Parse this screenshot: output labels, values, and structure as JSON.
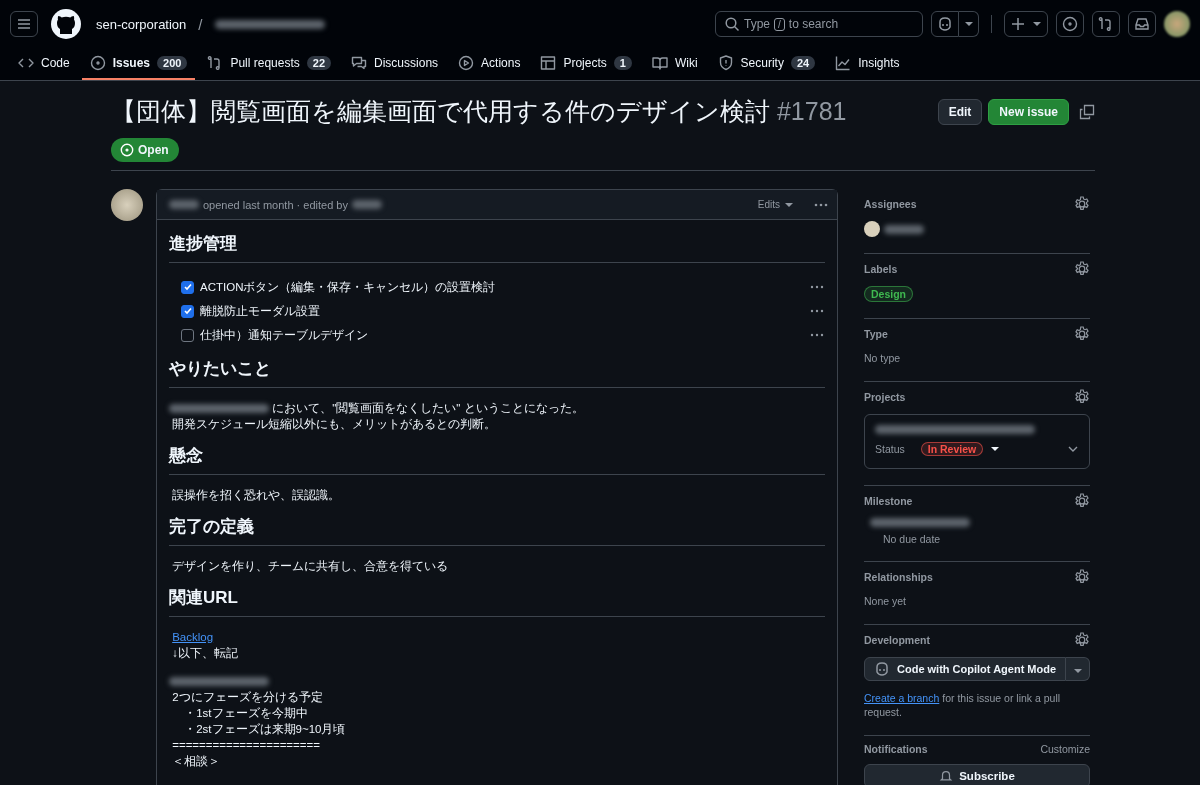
{
  "header": {
    "org": "sen-corporation",
    "separator": "/",
    "search": {
      "before": "Type",
      "key": "/",
      "after": "to search"
    }
  },
  "repo_tabs": [
    {
      "label": "Code",
      "selected": false
    },
    {
      "label": "Issues",
      "count": "200",
      "selected": true
    },
    {
      "label": "Pull requests",
      "count": "22",
      "selected": false
    },
    {
      "label": "Discussions",
      "selected": false
    },
    {
      "label": "Actions",
      "selected": false
    },
    {
      "label": "Projects",
      "count": "1",
      "selected": false
    },
    {
      "label": "Wiki",
      "selected": false
    },
    {
      "label": "Security",
      "count": "24",
      "selected": false
    },
    {
      "label": "Insights",
      "selected": false
    }
  ],
  "issue": {
    "title": "【団体】閲覧画面を編集画面で代用する件のデザイン検討",
    "number": "#1781",
    "state": "Open",
    "buttons": [
      "Edit",
      "New issue"
    ]
  },
  "comment": {
    "meta": "opened last month · edited by",
    "edits": "Edits",
    "blocks": [
      {
        "kind": "heading",
        "text": "進捗管理"
      },
      {
        "kind": "tasks",
        "items": [
          {
            "text": "ACTIONボタン（編集・保存・キャンセル）の設置検討",
            "checked": true
          },
          {
            "text": "離脱防止モーダル設置",
            "checked": true
          },
          {
            "text": "仕掛中）通知テーブルデザイン",
            "checked": false
          }
        ]
      },
      {
        "kind": "heading",
        "text": "やりたいこと"
      },
      {
        "kind": "paragraph",
        "lines": [
          {
            "text": "において、\"閲覧画面をなくしたい\" ということになった。",
            "redacted_prefix": true
          },
          {
            "text": "開発スケジュール短縮以外にも、メリットがあるとの判断。"
          }
        ]
      },
      {
        "kind": "heading",
        "text": "懸念"
      },
      {
        "kind": "paragraph",
        "lines": [
          {
            "text": "誤操作を招く恐れや、誤認識。"
          }
        ]
      },
      {
        "kind": "heading",
        "text": "完了の定義"
      },
      {
        "kind": "paragraph",
        "lines": [
          {
            "text": "デザインを作り、チームに共有し、合意を得ている"
          }
        ]
      },
      {
        "kind": "heading",
        "text": "関連URL"
      },
      {
        "kind": "paragraph",
        "lines": [
          {
            "text": "Backlog",
            "link": true
          },
          {
            "text": "↓以下、転記"
          }
        ]
      },
      {
        "kind": "paragraph",
        "lines": [
          {
            "redacted_prefix": true
          },
          {
            "text": "2つにフェーズを分ける予定"
          },
          {
            "text": "　・1stフェーズを今期中"
          },
          {
            "text": "　・2stフェーズは来期9~10月頃"
          },
          {
            "text": "======================"
          },
          {
            "text": "＜相談＞"
          }
        ]
      }
    ]
  },
  "sidebar": [
    {
      "kind": "assignees",
      "title": "Assignees"
    },
    {
      "kind": "labels",
      "title": "Labels",
      "labels": [
        {
          "name": "Design",
          "color": "#3fb950"
        }
      ]
    },
    {
      "kind": "text",
      "title": "Type",
      "text": "No type"
    },
    {
      "kind": "projects",
      "title": "Projects",
      "status_label": "Status",
      "status": "In Review"
    },
    {
      "kind": "milestone",
      "title": "Milestone",
      "note": "No due date"
    },
    {
      "kind": "text",
      "title": "Relationships",
      "text": "None yet"
    },
    {
      "kind": "development",
      "title": "Development",
      "button": "Code with Copilot Agent Mode",
      "link": "Create a branch",
      "rest": "for this issue or link a pull request."
    },
    {
      "kind": "notifications",
      "title": "Notifications",
      "action": "Customize",
      "button": "Subscribe"
    }
  ]
}
